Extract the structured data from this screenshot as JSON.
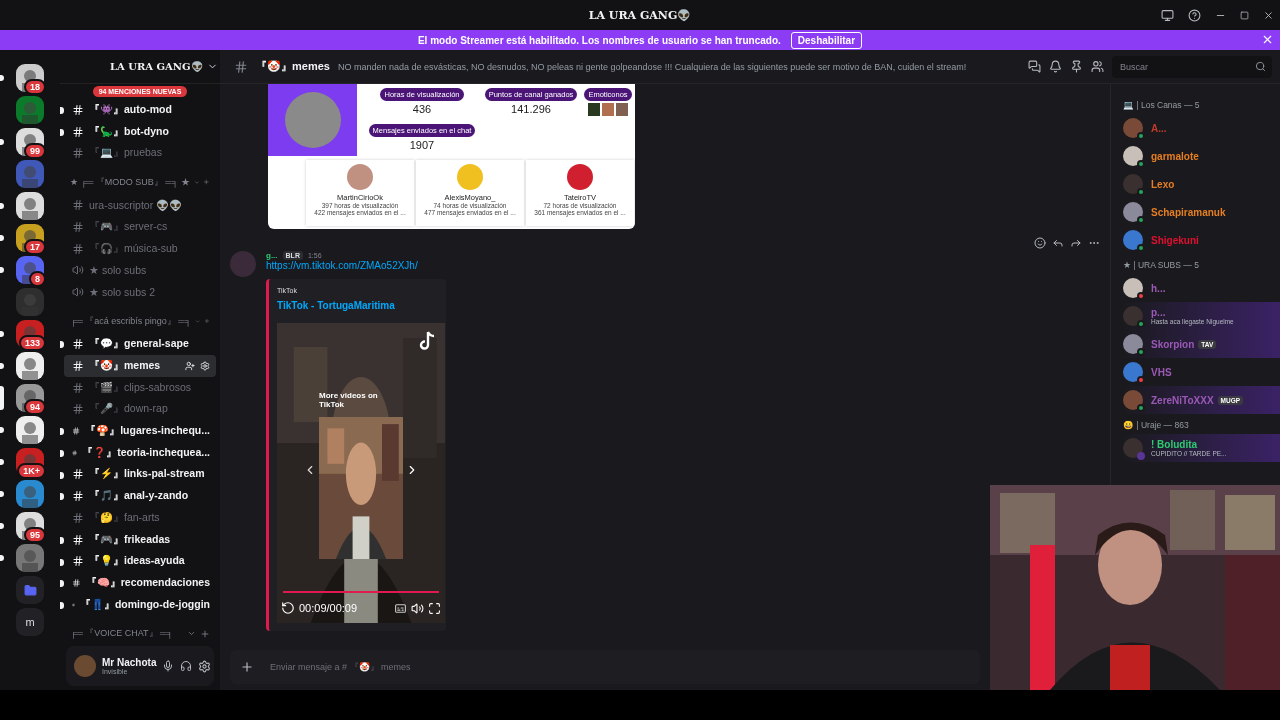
{
  "titlebar": {
    "title": "LA URA GANG👽"
  },
  "streamer_banner": {
    "text": "El modo Streamer está habilitado. Los nombres de usuario se han truncado.",
    "button": "Deshabilitar"
  },
  "servers": [
    {
      "kind": "server",
      "unread": true,
      "badge": "18"
    },
    {
      "kind": "server",
      "unread": false
    },
    {
      "kind": "server",
      "unread": true,
      "badge": "99"
    },
    {
      "kind": "server",
      "unread": false
    },
    {
      "kind": "server",
      "unread": true
    },
    {
      "kind": "server",
      "unread": true,
      "badge": "17"
    },
    {
      "kind": "server",
      "unread": true,
      "badge": "8"
    },
    {
      "kind": "server",
      "unread": false
    },
    {
      "kind": "server",
      "unread": true,
      "badge": "133"
    },
    {
      "kind": "server",
      "unread": true
    },
    {
      "kind": "server",
      "unread": false,
      "selected": true,
      "badge": "94"
    },
    {
      "kind": "server",
      "unread": true
    },
    {
      "kind": "server",
      "unread": true,
      "badge": "1K+"
    },
    {
      "kind": "server",
      "unread": true
    },
    {
      "kind": "server",
      "unread": true,
      "badge": "95"
    },
    {
      "kind": "server",
      "unread": true
    },
    {
      "kind": "folder",
      "unread": false
    },
    {
      "kind": "letter",
      "unread": false,
      "label": "m"
    }
  ],
  "server_name": "LA URA GANG👽",
  "mentions_badge": "94 MENCIONES NUEVAS",
  "channels": [
    {
      "kind": "text",
      "label": "『👾』auto-mod",
      "unread": true,
      "selected": false
    },
    {
      "kind": "text",
      "label": "『🦕』bot-dyno",
      "unread": true,
      "selected": false
    },
    {
      "kind": "text",
      "label": "『💻』pruebas",
      "unread": false,
      "selected": false
    },
    {
      "kind": "category",
      "label": "★ ╒═ 『MODO SUB』 ═╕ ★"
    },
    {
      "kind": "text",
      "label": "ura-suscriptor 👽👽",
      "unread": false,
      "selected": false
    },
    {
      "kind": "text",
      "label": "『🎮』server-cs",
      "unread": false,
      "selected": false
    },
    {
      "kind": "text",
      "label": "『🎧』música-sub",
      "unread": false,
      "selected": false
    },
    {
      "kind": "voice",
      "label": "★ solo subs",
      "unread": false,
      "selected": false
    },
    {
      "kind": "voice",
      "label": "★ solo subs 2",
      "unread": false,
      "selected": false
    },
    {
      "kind": "category",
      "label": "╒═ 『acá escribís pingo』 ═╕"
    },
    {
      "kind": "text",
      "label": "『💬』general-sape",
      "unread": true,
      "selected": false
    },
    {
      "kind": "text",
      "label": "『🤡』memes",
      "unread": false,
      "selected": true
    },
    {
      "kind": "text",
      "label": "『🎬』clips-sabrosos",
      "unread": false,
      "selected": false
    },
    {
      "kind": "text",
      "label": "『🎤』down-rap",
      "unread": false,
      "selected": false
    },
    {
      "kind": "text",
      "label": "『🍄』lugares-inchequ...",
      "unread": true,
      "selected": false
    },
    {
      "kind": "text",
      "label": "『❓』teoria-inchequea...",
      "unread": true,
      "selected": false
    },
    {
      "kind": "text",
      "label": "『⚡』links-pal-stream",
      "unread": true,
      "selected": false
    },
    {
      "kind": "text",
      "label": "『🎵』anal-y-zando",
      "unread": true,
      "selected": false
    },
    {
      "kind": "text",
      "label": "『🤔』fan-arts",
      "unread": false,
      "selected": false
    },
    {
      "kind": "text",
      "label": "『🎮』frikeadas",
      "unread": true,
      "selected": false
    },
    {
      "kind": "text",
      "label": "『💡』ideas-ayuda",
      "unread": true,
      "selected": false
    },
    {
      "kind": "text",
      "label": "『🧠』recomendaciones",
      "unread": true,
      "selected": false
    },
    {
      "kind": "text",
      "label": "『👖』domingo-de-joggin",
      "unread": true,
      "selected": false
    },
    {
      "kind": "category",
      "label": "╒═ 『VOICE CHAT』 ═╕"
    }
  ],
  "user_panel": {
    "name": "Mr Nachota",
    "status": "Invisible"
  },
  "chat_header": {
    "channel": "『🤡』memes",
    "topic": "NO manden nada de esvásticas, NO desnudos, NO peleas ni gente golpeandose !!! Cualquiera de las siguientes puede ser motivo de BAN, cuiden el stream!",
    "search_placeholder": "Buscar"
  },
  "stats_card": {
    "stats": [
      {
        "label": "Horas de visualización",
        "value": "436"
      },
      {
        "label": "Puntos de canal ganados",
        "value": "141.296"
      },
      {
        "label": "Mensajes enviados en el chat",
        "value": "1907"
      }
    ],
    "emotes_label": "Emoticonos",
    "top_channels": [
      {
        "name": "MartinCirioOk",
        "hours": "397 horas de visualización",
        "messages": "422 mensajes enviados en el ..."
      },
      {
        "name": "AlexisMoyano_",
        "hours": "74 horas de visualización",
        "messages": "477 mensajes enviados en el ..."
      },
      {
        "name": "TateiroTV",
        "hours": "72 horas de visualización",
        "messages": "361 mensajes enviados en el ..."
      }
    ]
  },
  "message": {
    "author": "g...",
    "tag": "BLR",
    "time": "1:56",
    "link": "https://vm.tiktok.com/ZMAo52XJh/",
    "embed": {
      "provider": "TikTok",
      "title": "TikTok - TortugaMaritima",
      "more_videos": "More videos on TikTok",
      "time": "00:09/00:09",
      "level": 1
    }
  },
  "composer": {
    "placeholder": "Enviar mensaje a # 『🤡』 memes"
  },
  "member_groups": [
    {
      "title": "💻 | Los Canas — 5",
      "members": [
        {
          "name": "A...",
          "color": "#c0392b",
          "dnd": false,
          "streaming": false
        },
        {
          "name": "garmalote",
          "color": "#e67e22",
          "dnd": false,
          "streaming": false
        },
        {
          "name": "Lexo",
          "color": "#e67e22",
          "dnd": false,
          "streaming": false
        },
        {
          "name": "Schapiramanuk",
          "color": "#e67e22",
          "dnd": false,
          "streaming": false
        },
        {
          "name": "Shigekuni",
          "color": "#e0102f",
          "dnd": false,
          "streaming": false
        }
      ]
    },
    {
      "title": "★ | URA SUBS — 5",
      "members": [
        {
          "name": "h...",
          "color": "#9b59b6",
          "dnd": true,
          "streaming": false,
          "nameplate": false
        },
        {
          "name": "p...",
          "color": "#9b59b6",
          "dnd": false,
          "streaming": false,
          "subtitle": "Hasta aca llegaste Niguelme",
          "nameplate": true
        },
        {
          "name": "Skorpion",
          "color": "#9b59b6",
          "dnd": false,
          "streaming": false,
          "tag": "TAV",
          "nameplate": true
        },
        {
          "name": "VHS",
          "color": "#9b59b6",
          "dnd": true,
          "streaming": false,
          "nameplate": false
        },
        {
          "name": "ZereNiToXXX",
          "color": "#9b59b6",
          "dnd": false,
          "streaming": false,
          "tag": "MUGP",
          "nameplate": true
        }
      ]
    },
    {
      "title": "😀 | Uraje — 863",
      "members": [
        {
          "name": "! Boludita",
          "color": "#2ecc71",
          "dnd": false,
          "streaming": true,
          "subtitle": "CUPIDITO // TARDE PE...",
          "nameplate": true
        }
      ]
    }
  ]
}
